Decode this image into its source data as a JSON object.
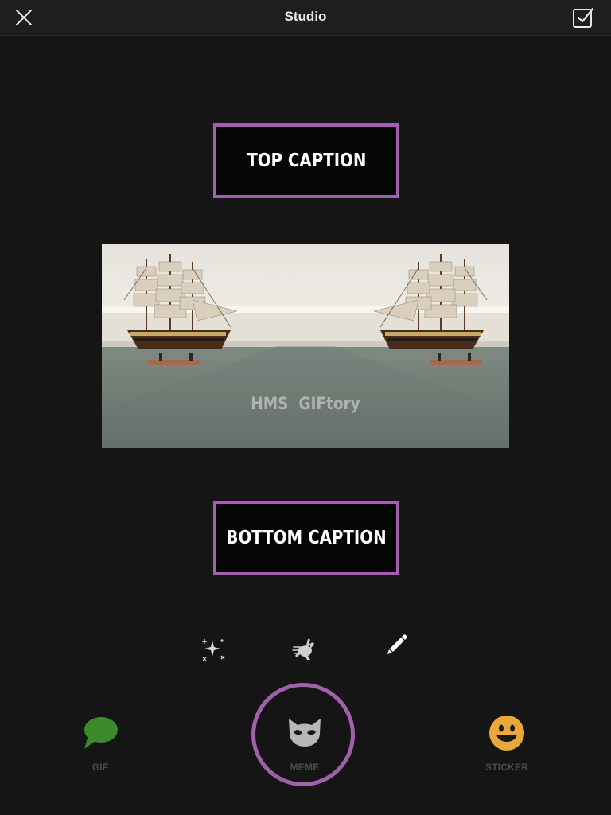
{
  "header": {
    "title": "Studio",
    "close_icon": "close-icon",
    "done_icon": "checkbox-checked-icon"
  },
  "captions": {
    "top": "TOP CAPTION",
    "bottom": "BOTTOM CAPTION"
  },
  "preview": {
    "watermark": "HMS  GIFtory",
    "description_icon": "mirrored-ship-image"
  },
  "tools": [
    {
      "name": "effects",
      "icon": "sparkles-icon"
    },
    {
      "name": "speed",
      "icon": "running-rabbit-icon"
    },
    {
      "name": "draw",
      "icon": "pencil-icon"
    }
  ],
  "tabs": [
    {
      "label": "GIF",
      "icon": "speech-bubble-icon",
      "color": "#3c8a2b"
    },
    {
      "label": "MEME",
      "icon": "cat-mask-icon",
      "color": "#b7b7b7",
      "selected": true
    },
    {
      "label": "STICKER",
      "icon": "smiley-icon",
      "color": "#e9a93a"
    }
  ],
  "colors": {
    "accent": "#a25fae",
    "background": "#151515",
    "header": "#1e1e1e"
  }
}
